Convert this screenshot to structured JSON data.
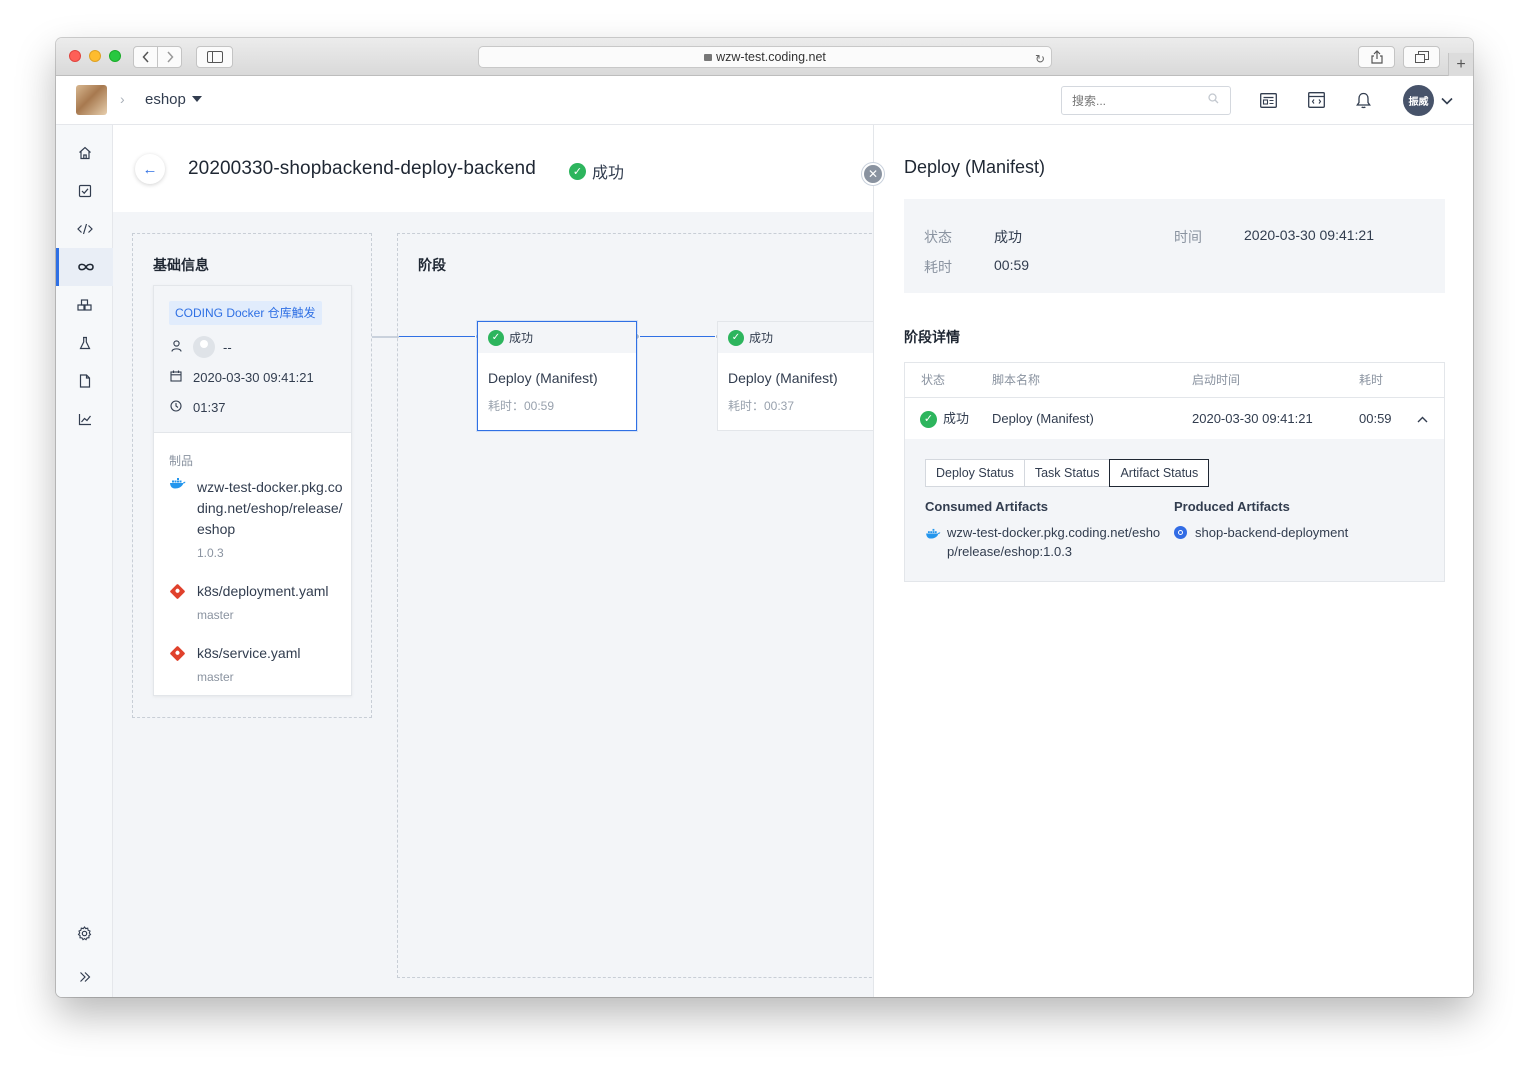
{
  "browser": {
    "url": "wzw-test.coding.net"
  },
  "header": {
    "project": "eshop",
    "search_placeholder": "搜索...",
    "avatar_label": "振威"
  },
  "page": {
    "title": "20200330-shopbackend-deploy-backend",
    "status": "成功"
  },
  "basic_info": {
    "heading": "基础信息",
    "trigger_tag": "CODING Docker 仓库触发",
    "user": "--",
    "date": "2020-03-30 09:41:21",
    "duration": "01:37",
    "artifacts_label": "制品",
    "artifacts": [
      {
        "icon": "docker-icon",
        "name": "wzw-test-docker.pkg.coding.net/eshop/release/eshop",
        "sub": "1.0.3"
      },
      {
        "icon": "git-icon",
        "name": "k8s/deployment.yaml",
        "sub": "master"
      },
      {
        "icon": "git-icon",
        "name": "k8s/service.yaml",
        "sub": "master"
      }
    ]
  },
  "stages": {
    "heading": "阶段",
    "cards": [
      {
        "status": "成功",
        "name": "Deploy (Manifest)",
        "time": "耗时：00:59"
      },
      {
        "status": "成功",
        "name": "Deploy (Manifest)",
        "time": "耗时：00:37"
      }
    ]
  },
  "panel": {
    "title": "Deploy (Manifest)",
    "summary": {
      "status_k": "状态",
      "status_v": "成功",
      "time_k": "时间",
      "time_v": "2020-03-30 09:41:21",
      "dur_k": "耗时",
      "dur_v": "00:59"
    },
    "detail_label": "阶段详情",
    "table": {
      "headers": [
        "状态",
        "脚本名称",
        "启动时间",
        "耗时"
      ],
      "row": {
        "status": "成功",
        "script": "Deploy (Manifest)",
        "start": "2020-03-30 09:41:21",
        "duration": "00:59"
      }
    },
    "tabs": [
      "Deploy Status",
      "Task Status",
      "Artifact Status"
    ],
    "active_tab": "Artifact Status",
    "consumed_label": "Consumed Artifacts",
    "consumed_item": "wzw-test-docker.pkg.coding.net/eshop/release/eshop:1.0.3",
    "produced_label": "Produced Artifacts",
    "produced_item": "shop-backend-deployment"
  },
  "colors": {
    "accent": "#2f70e4",
    "success": "#2db55d"
  }
}
